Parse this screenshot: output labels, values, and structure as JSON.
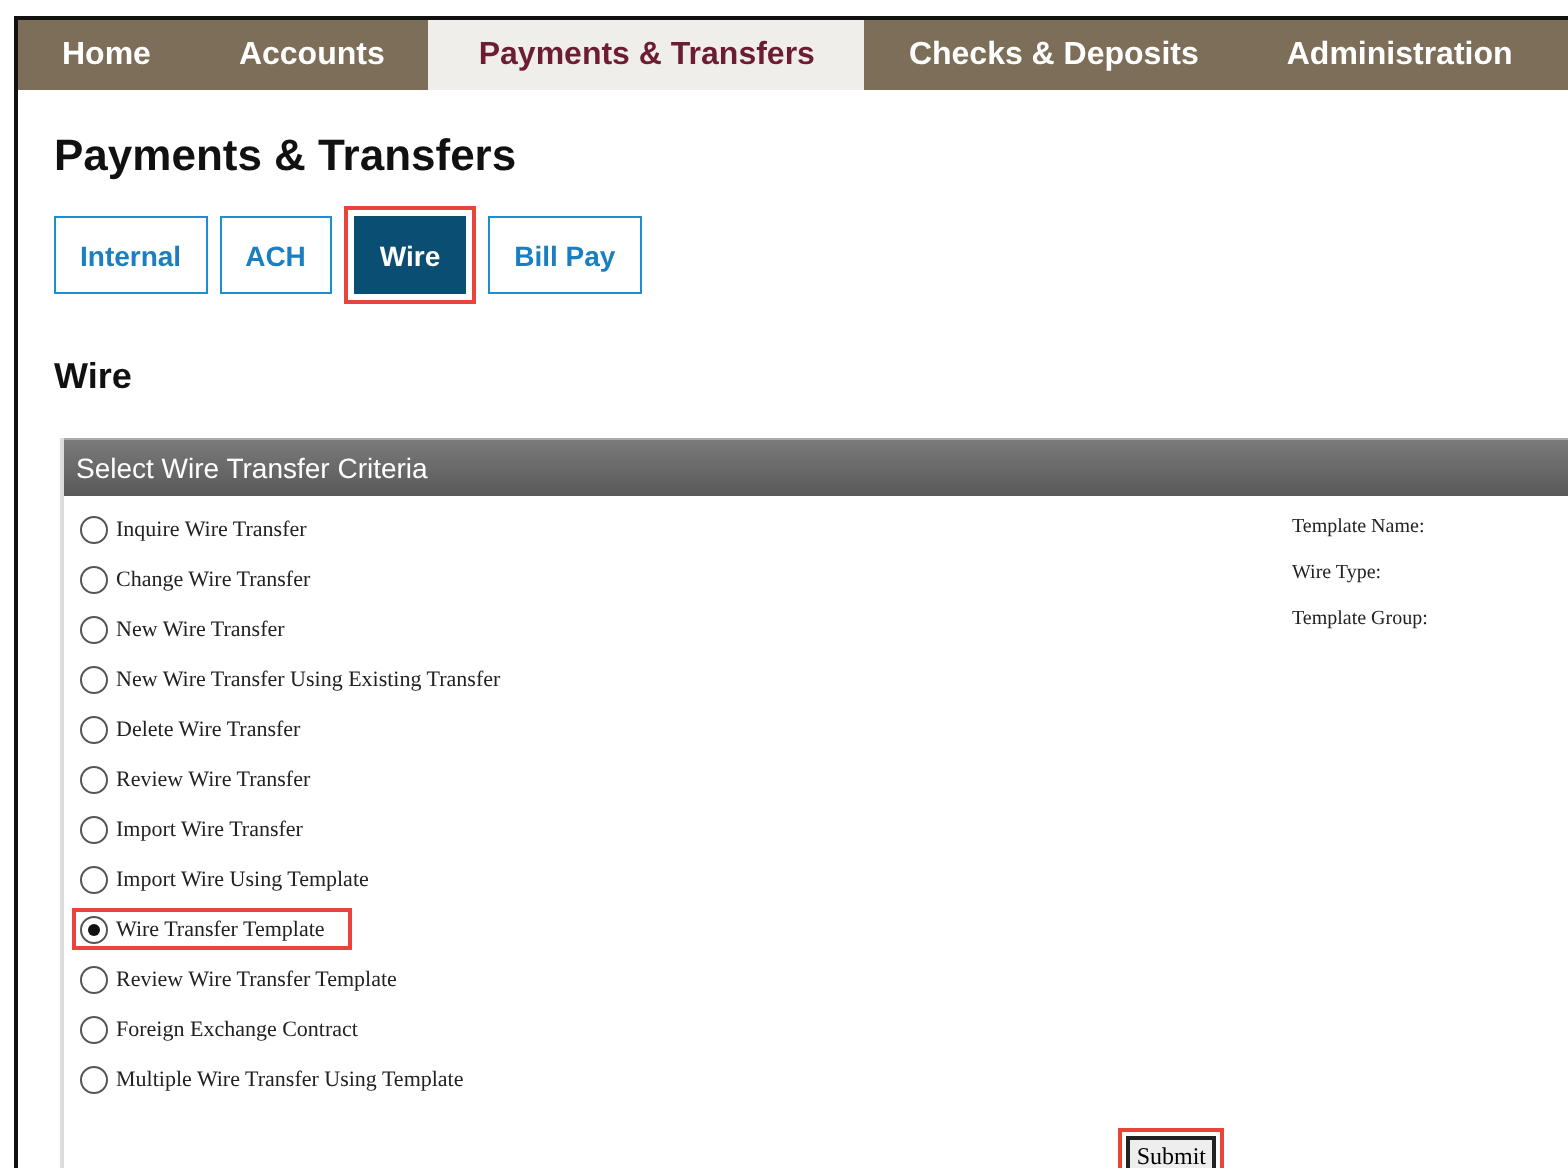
{
  "nav": [
    {
      "label": "Home",
      "selected": false
    },
    {
      "label": "Accounts",
      "selected": false
    },
    {
      "label": "Payments & Transfers",
      "selected": true
    },
    {
      "label": "Checks & Deposits",
      "selected": false
    },
    {
      "label": "Administration",
      "selected": false
    }
  ],
  "page_title": "Payments & Transfers",
  "subtabs": [
    {
      "label": "Internal",
      "selected": false,
      "highlighted": false
    },
    {
      "label": "ACH",
      "selected": false,
      "highlighted": false
    },
    {
      "label": "Wire",
      "selected": true,
      "highlighted": true
    },
    {
      "label": "Bill Pay",
      "selected": false,
      "highlighted": false
    }
  ],
  "section_title": "Wire",
  "panel": {
    "title": "Select Wire Transfer Criteria",
    "options": [
      {
        "label": "Inquire Wire Transfer",
        "selected": false,
        "highlighted": false
      },
      {
        "label": "Change Wire Transfer",
        "selected": false,
        "highlighted": false
      },
      {
        "label": "New Wire Transfer",
        "selected": false,
        "highlighted": false
      },
      {
        "label": "New Wire Transfer Using Existing Transfer",
        "selected": false,
        "highlighted": false
      },
      {
        "label": "Delete Wire Transfer",
        "selected": false,
        "highlighted": false
      },
      {
        "label": "Review Wire Transfer",
        "selected": false,
        "highlighted": false
      },
      {
        "label": "Import Wire Transfer",
        "selected": false,
        "highlighted": false
      },
      {
        "label": "Import Wire Using Template",
        "selected": false,
        "highlighted": false
      },
      {
        "label": "Wire Transfer Template",
        "selected": true,
        "highlighted": true
      },
      {
        "label": "Review Wire Transfer Template",
        "selected": false,
        "highlighted": false
      },
      {
        "label": "Foreign Exchange Contract",
        "selected": false,
        "highlighted": false
      },
      {
        "label": "Multiple Wire Transfer Using Template",
        "selected": false,
        "highlighted": false
      }
    ],
    "fields": [
      "Template Name:",
      "Wire Type:",
      "Template Group:"
    ],
    "submit": {
      "label": "Submit",
      "highlighted": true
    }
  }
}
